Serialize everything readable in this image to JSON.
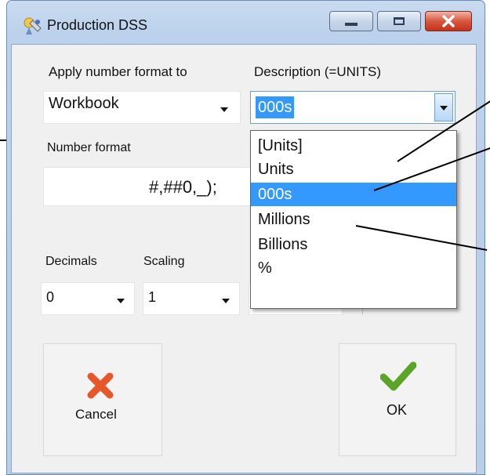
{
  "window": {
    "title": "Production DSS"
  },
  "apply_format": {
    "label": "Apply number format to",
    "value": "Workbook"
  },
  "description": {
    "label": "Description (=UNITS)",
    "value": "000s",
    "options": [
      "[Units]",
      "Units",
      "000s",
      "Millions",
      "Billions",
      "%"
    ],
    "selected_index": 2
  },
  "number_format": {
    "label": "Number format",
    "value": "#,##0,_);"
  },
  "decimals": {
    "label": "Decimals",
    "value": "0"
  },
  "scaling": {
    "label": "Scaling",
    "value": "1"
  },
  "buttons": {
    "cancel": "Cancel",
    "ok": "OK"
  },
  "colors": {
    "selection": "#3399ff",
    "cancel_icon": "#e8572a",
    "ok_icon": "#5aa528"
  }
}
